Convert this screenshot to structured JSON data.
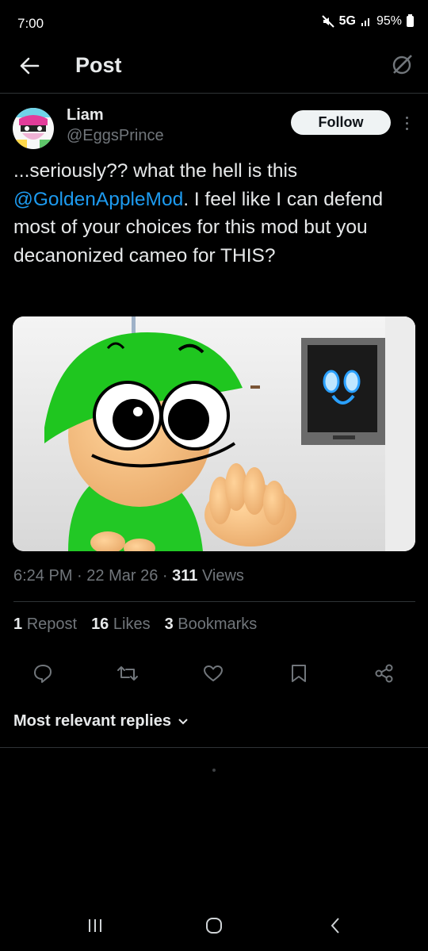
{
  "status_bar": {
    "time": "7:00",
    "network": "5G",
    "battery": "95%"
  },
  "header": {
    "title": "Post",
    "back_icon": "arrow-left-icon",
    "grok_icon": "grok-icon"
  },
  "author": {
    "name": "Liam",
    "handle": "@EggsPrince",
    "follow_label": "Follow"
  },
  "tweet": {
    "text_before": "...seriously?? what the hell is this ",
    "mention": "@GoldenAppleMod",
    "text_after": ". I feel like I can defend most of your choices for this mod but you decanonized cameo for THIS?",
    "time": "6:24 PM",
    "date": "22 Mar 26",
    "views_count": "311",
    "views_label": "Views"
  },
  "stats": {
    "reposts_count": "1",
    "reposts_label": "Repost",
    "likes_count": "16",
    "likes_label": "Likes",
    "bookmarks_count": "3",
    "bookmarks_label": "Bookmarks"
  },
  "actions": [
    "reply-icon",
    "repost-icon",
    "like-icon",
    "bookmark-icon",
    "share-icon"
  ],
  "replies": {
    "sort_label": "Most relevant replies"
  },
  "colors": {
    "accent": "#1d9bf0",
    "secondary_text": "#71767b",
    "divider": "#2f3336"
  }
}
